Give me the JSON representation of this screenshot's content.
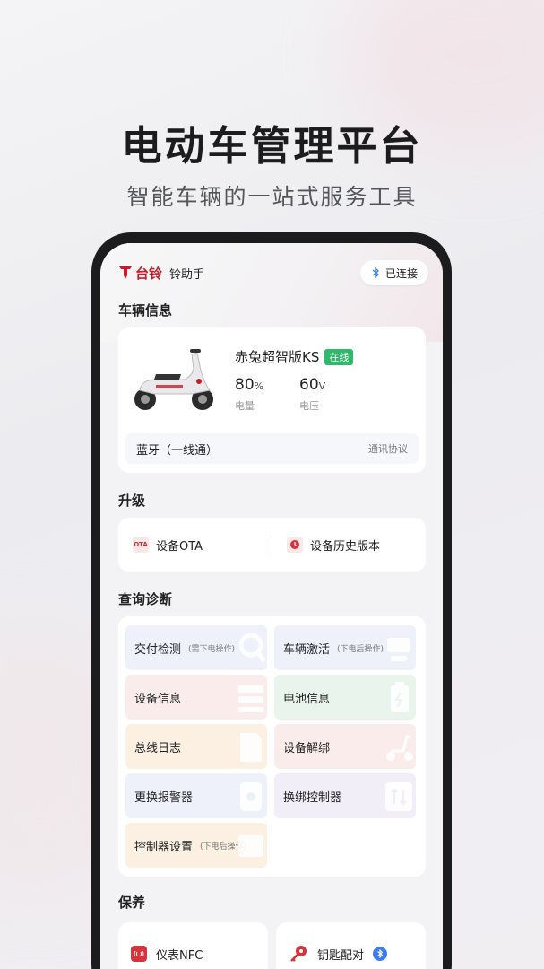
{
  "hero": {
    "title": "电动车管理平台",
    "subtitle": "智能车辆的一站式服务工具"
  },
  "app": {
    "logo_text": "台铃",
    "name": "铃助手",
    "connection_status": "已连接",
    "connection_icon": "bluetooth-icon"
  },
  "vehicle": {
    "section_title": "车辆信息",
    "model": "赤兔超智版KS",
    "status_badge": "在线",
    "battery": {
      "value": "80",
      "unit": "%",
      "label": "电量"
    },
    "voltage": {
      "value": "60",
      "unit": "V",
      "label": "电压"
    },
    "connection_mode": "蓝牙（一线通）",
    "protocol_label": "通讯协议"
  },
  "upgrade": {
    "section_title": "升级",
    "items": [
      {
        "label": "设备OTA",
        "icon": "ota-icon",
        "icon_text": "OTA"
      },
      {
        "label": "设备历史版本",
        "icon": "history-icon"
      }
    ]
  },
  "diagnostics": {
    "section_title": "查询诊断",
    "tiles": [
      {
        "label": "交付检测",
        "note": "(需下电操作)",
        "icon": "search-icon"
      },
      {
        "label": "车辆激活",
        "note": "(下电后操作)",
        "icon": "activate-icon"
      },
      {
        "label": "设备信息",
        "note": "",
        "icon": "device-info-icon"
      },
      {
        "label": "电池信息",
        "note": "",
        "icon": "battery-icon"
      },
      {
        "label": "总线日志",
        "note": "",
        "icon": "log-icon"
      },
      {
        "label": "设备解绑",
        "note": "",
        "icon": "scooter-unbind-icon"
      },
      {
        "label": "更换报警器",
        "note": "",
        "icon": "alarm-icon"
      },
      {
        "label": "换绑控制器",
        "note": "",
        "icon": "controller-swap-icon"
      },
      {
        "label": "控制器设置",
        "note": "(下电后操作)",
        "icon": "controller-settings-icon"
      }
    ]
  },
  "maintenance": {
    "section_title": "保养",
    "items": [
      {
        "label": "仪表NFC",
        "icon": "nfc-icon"
      },
      {
        "label": "钥匙配对",
        "icon": "key-icon",
        "badge_icon": "bluetooth-icon"
      }
    ]
  },
  "colors": {
    "brand": "#c41e2a",
    "online": "#2dba6a",
    "bluetooth": "#3b7cf3"
  }
}
